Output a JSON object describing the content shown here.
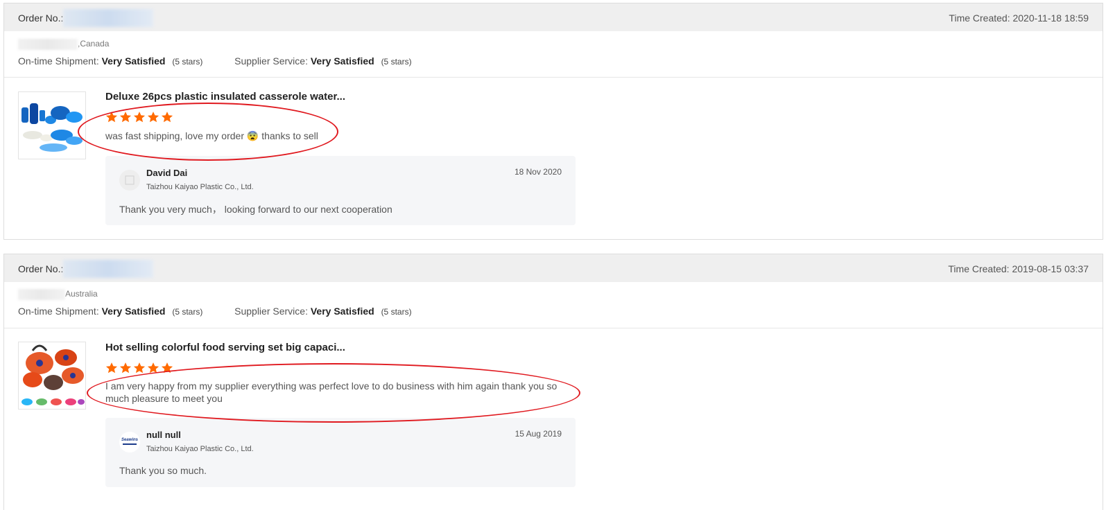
{
  "labels": {
    "order_no": "Order No.:",
    "on_time_shipment": "On-time Shipment:",
    "supplier_service": "Supplier Service:"
  },
  "colors": {
    "star": "#ff6a00",
    "highlight_ellipse": "#e0191f"
  },
  "orders": [
    {
      "time_created": "Time Created: 2020-11-18 18:59",
      "buyer_country": ",Canada",
      "on_time_value": "Very Satisfied",
      "on_time_stars": "(5 stars)",
      "service_value": "Very Satisfied",
      "service_stars": "(5 stars)",
      "product_title": "Deluxe 26pcs plastic insulated casserole water...",
      "rating": 5,
      "review_text": "was fast shipping, love my order 😨 thanks to sell",
      "reply": {
        "name": "David Dai",
        "company": "Taizhou Kaiyao Plastic Co., Ltd.",
        "date": "18 Nov 2020",
        "text": "Thank you very much， looking forward to our next cooperation"
      }
    },
    {
      "time_created": "Time Created: 2019-08-15 03:37",
      "buyer_country": "Australia",
      "on_time_value": "Very Satisfied",
      "on_time_stars": "(5 stars)",
      "service_value": "Very Satisfied",
      "service_stars": "(5 stars)",
      "product_title": "Hot selling colorful food serving set big capaci...",
      "rating": 5,
      "review_text": "I am very happy from my supplier  everything was  perfect love to do business with him again thank you so much pleasure to meet you",
      "reply": {
        "name": "null null",
        "company": "Taizhou Kaiyao Plastic Co., Ltd.",
        "date": "15 Aug 2019",
        "text": "Thank you so much.",
        "avatar_logo_text": "Seawins"
      }
    }
  ]
}
